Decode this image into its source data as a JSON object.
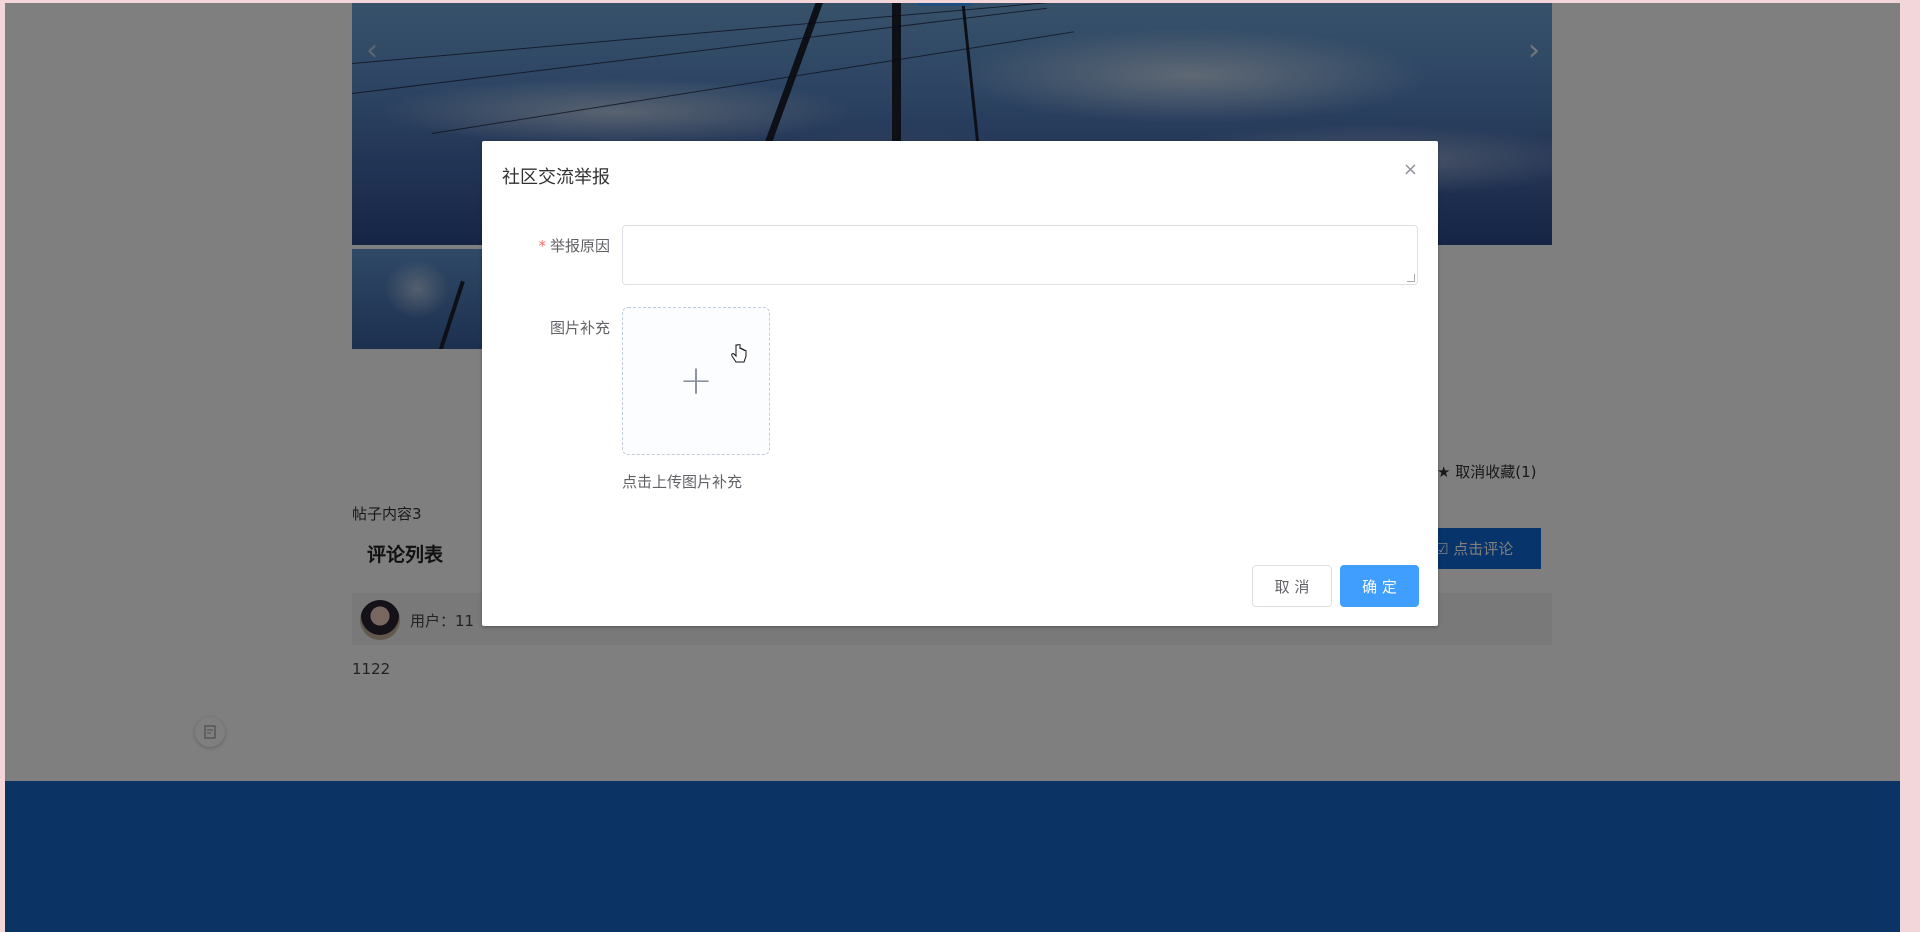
{
  "carousel": {
    "prev_arrow": "‹",
    "next_arrow": "›"
  },
  "post": {
    "favorite_label": "★ 取消收藏(1)",
    "content": "帖子内容3"
  },
  "comments": {
    "title": "评论列表",
    "add_button": "☑ 点击评论",
    "items": [
      {
        "user": "用户：11",
        "text": "1122"
      }
    ]
  },
  "dialog": {
    "title": "社区交流举报",
    "close_icon": "×",
    "reason_label": "举报原因",
    "required_mark": "*",
    "reason_value": "",
    "image_label": "图片补充",
    "upload_plus": "+",
    "upload_tip": "点击上传图片补充",
    "cancel_label": "取 消",
    "confirm_label": "确 定"
  },
  "colors": {
    "primary": "#409eff",
    "footer": "#1766c6",
    "comment_button": "#0e68d6",
    "required": "#f56c6c"
  }
}
